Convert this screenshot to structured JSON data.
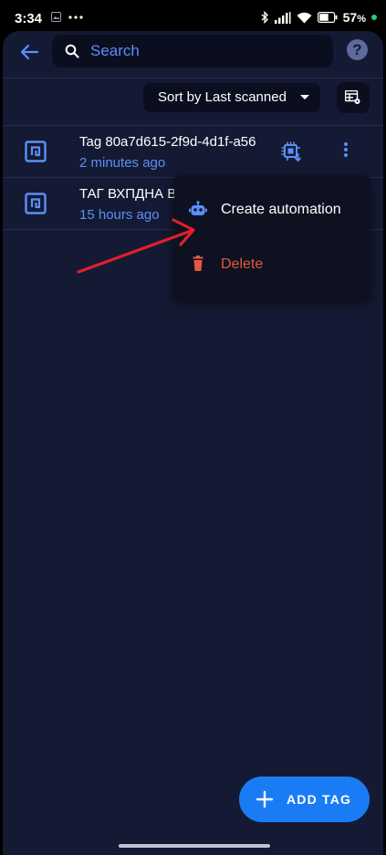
{
  "status_bar": {
    "time": "3:34",
    "battery": "57",
    "battery_unit": "%"
  },
  "header": {
    "search_placeholder": "Search",
    "help_label": "?"
  },
  "toolbar": {
    "sort_label": "Sort by Last scanned"
  },
  "tags": [
    {
      "title": "Tag 80a7d615-2f9d-4d1f-a56",
      "subtitle": "2 minutes ago"
    },
    {
      "title": "ТАГ ВХПДНА ВРАТА",
      "subtitle": "15 hours ago"
    }
  ],
  "context_menu": {
    "create_automation": "Create automation",
    "delete": "Delete"
  },
  "fab": {
    "label": "ADD TAG"
  },
  "colors": {
    "accent": "#5b8ff9",
    "fab": "#1a7cf5",
    "danger": "#e3583f",
    "background": "#141a33",
    "annotation_arrow": "#e0202c"
  }
}
